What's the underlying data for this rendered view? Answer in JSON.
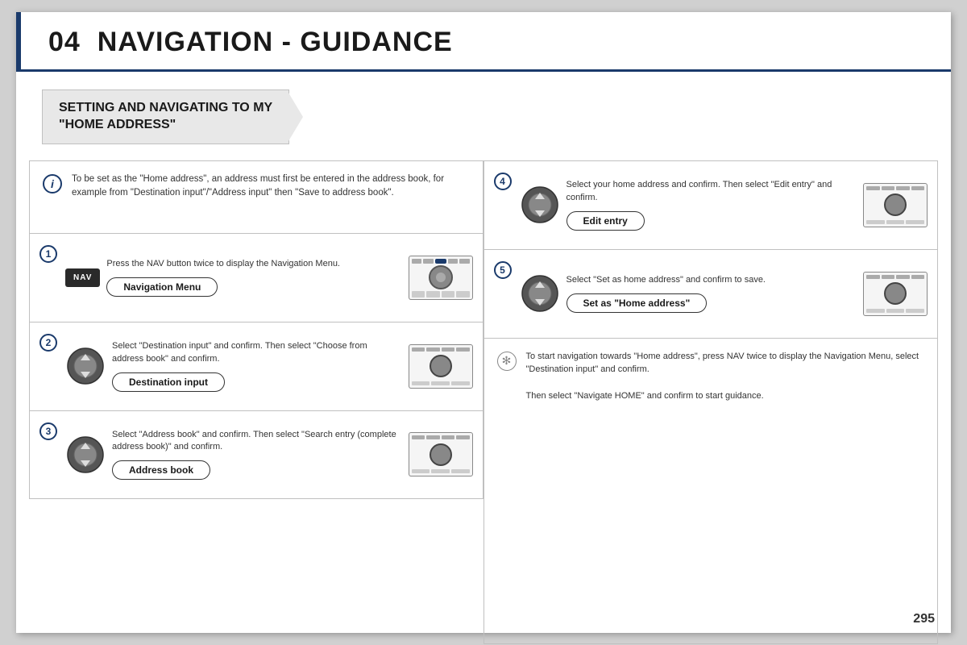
{
  "header": {
    "chapter": "04",
    "title": "NAVIGATION - GUIDANCE"
  },
  "section": {
    "title_line1": "SETTING AND NAVIGATING TO MY",
    "title_line2": "\"HOME ADDRESS\""
  },
  "info_box": {
    "text": "To be set as the \"Home address\", an address must first be entered in the address book, for example from \"Destination input\"/\"Address input\" then \"Save to address book\"."
  },
  "steps": {
    "step1": {
      "number": "1",
      "nav_label": "NAV",
      "text": "Press the NAV button twice to display the Navigation Menu.",
      "pill": "Navigation Menu"
    },
    "step2": {
      "number": "2",
      "text": "Select \"Destination input\" and confirm. Then select \"Choose from address book\" and confirm.",
      "pill": "Destination input"
    },
    "step3": {
      "number": "3",
      "text": "Select \"Address book\" and confirm. Then select \"Search entry (complete address book)\" and confirm.",
      "pill": "Address book"
    },
    "step4": {
      "number": "4",
      "text": "Select your home address and confirm. Then select \"Edit entry\" and confirm.",
      "pill": "Edit entry"
    },
    "step5": {
      "number": "5",
      "text": "Select \"Set as home address\" and confirm to save.",
      "pill": "Set as \"Home address\""
    }
  },
  "tip": {
    "text": "To start navigation towards \"Home address\", press NAV twice to display the Navigation Menu, select \"Destination input\" and confirm.\nThen select \"Navigate HOME\" and confirm to start guidance."
  },
  "page_number": "295"
}
